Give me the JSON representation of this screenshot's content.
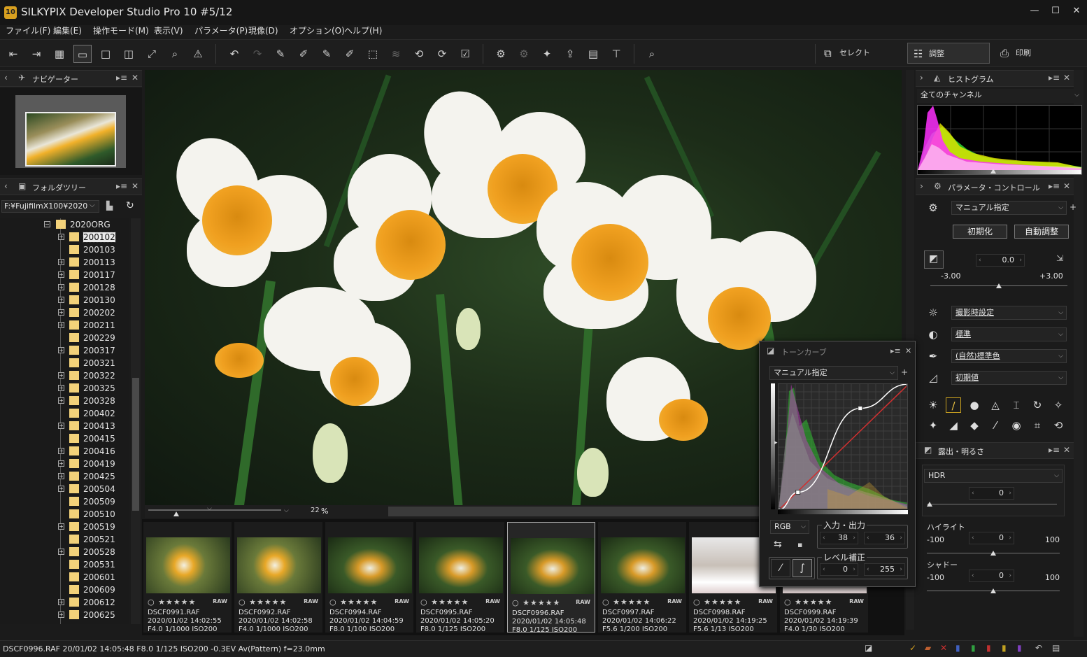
{
  "app": {
    "title": "SILKYPIX Developer Studio Pro 10   #5/12",
    "logo": "10"
  },
  "window": {
    "minimize": "—",
    "maximize": "☐",
    "close": "✕"
  },
  "menu": [
    "ファイル(F)",
    "編集(E)",
    "操作モード(M)",
    "表示(V)",
    "パラメータ(P)",
    "現像(D)",
    "オプション(O)",
    "ヘルプ(H)"
  ],
  "toolbar": {
    "icons": [
      "prev-image-icon",
      "next-image-icon",
      "grid-view-icon",
      "preview-filmstrip-icon",
      "single-view-icon",
      "compare-view-icon",
      "fullscreen-icon",
      "zoom-icon",
      "warning-icon",
      "undo-icon",
      "redo-icon",
      "copy-param-icon",
      "paste-param-icon",
      "paste-param2-icon",
      "paste-param3-icon",
      "crop-tool-icon",
      "layers-icon",
      "rotate-left-icon",
      "rotate-right-icon",
      "check-icon",
      "develop-icon",
      "batch-develop-icon",
      "plugin-icon",
      "export-icon",
      "slideshow-icon",
      "tools-icon",
      "search-icon"
    ],
    "modes": {
      "select": "セレクト",
      "adjust": "調整",
      "print": "印刷"
    }
  },
  "navigator": {
    "title": "ナビゲーター"
  },
  "folder_tree": {
    "title": "フォルダツリー",
    "path": "F:¥FujifilmX100¥2020",
    "root": "2020ORG",
    "items": [
      {
        "label": "200102",
        "expand": true,
        "selected": true
      },
      {
        "label": "200103",
        "expand": false
      },
      {
        "label": "200113",
        "expand": true
      },
      {
        "label": "200117",
        "expand": true
      },
      {
        "label": "200128",
        "expand": true
      },
      {
        "label": "200130",
        "expand": true
      },
      {
        "label": "200202",
        "expand": true
      },
      {
        "label": "200211",
        "expand": true
      },
      {
        "label": "200229",
        "expand": false
      },
      {
        "label": "200317",
        "expand": true
      },
      {
        "label": "200321",
        "expand": false
      },
      {
        "label": "200322",
        "expand": true
      },
      {
        "label": "200325",
        "expand": true
      },
      {
        "label": "200328",
        "expand": true
      },
      {
        "label": "200402",
        "expand": false
      },
      {
        "label": "200413",
        "expand": true
      },
      {
        "label": "200415",
        "expand": false
      },
      {
        "label": "200416",
        "expand": true
      },
      {
        "label": "200419",
        "expand": true
      },
      {
        "label": "200425",
        "expand": true
      },
      {
        "label": "200504",
        "expand": true
      },
      {
        "label": "200509",
        "expand": false
      },
      {
        "label": "200510",
        "expand": false
      },
      {
        "label": "200519",
        "expand": true
      },
      {
        "label": "200521",
        "expand": false
      },
      {
        "label": "200528",
        "expand": true
      },
      {
        "label": "200531",
        "expand": false
      },
      {
        "label": "200601",
        "expand": false
      },
      {
        "label": "200609",
        "expand": false
      },
      {
        "label": "200612",
        "expand": true
      },
      {
        "label": "200625",
        "expand": true
      }
    ]
  },
  "viewer": {
    "zoom": "22",
    "zoom_unit": "%"
  },
  "filmstrip": [
    {
      "name": "DSCF0991.RAF",
      "date": "2020/01/02 14:02:55",
      "exp": "F4.0 1/1000 ISO200",
      "tone": "a"
    },
    {
      "name": "DSCF0992.RAF",
      "date": "2020/01/02 14:02:58",
      "exp": "F4.0 1/1000 ISO200",
      "tone": "a"
    },
    {
      "name": "DSCF0994.RAF",
      "date": "2020/01/02 14:04:59",
      "exp": "F8.0 1/100 ISO200",
      "tone": "b"
    },
    {
      "name": "DSCF0995.RAF",
      "date": "2020/01/02 14:05:20",
      "exp": "F8.0 1/125 ISO200",
      "tone": "b"
    },
    {
      "name": "DSCF0996.RAF",
      "date": "2020/01/02 14:05:48",
      "exp": "F8.0 1/125 ISO200",
      "tone": "b",
      "selected": true
    },
    {
      "name": "DSCF0997.RAF",
      "date": "2020/01/02 14:06:22",
      "exp": "F5.6 1/200 ISO200",
      "tone": "b"
    },
    {
      "name": "DSCF0998.RAF",
      "date": "2020/01/02 14:19:25",
      "exp": "F5.6 1/13 ISO200",
      "tone": "c"
    },
    {
      "name": "DSCF0999.RAF",
      "date": "2020/01/02 14:19:39",
      "exp": "F4.0 1/30 ISO200",
      "tone": "c"
    }
  ],
  "thumb_rating": "○ ★★★★★",
  "thumb_raw": "RAW",
  "status": {
    "text": "DSCF0996.RAF 20/01/02 14:05:48 F8.0 1/125 ISO200 -0.3EV Av(Pattern) f=23.0mm"
  },
  "histogram": {
    "title": "ヒストグラム",
    "channel": "全てのチャンネル"
  },
  "param_control": {
    "title": "パラメータ・コントロール",
    "preset": "マニュアル指定",
    "init_btn": "初期化",
    "auto_btn": "自動調整",
    "exposure_value": "0.0",
    "exposure_min": "-3.00",
    "exposure_max": "+3.00",
    "exposure_level": 0.5,
    "wb": "撮影時設定",
    "tone": "標準",
    "color": "(自然)標準色",
    "sharp": "初期値"
  },
  "exposure_panel": {
    "title": "露出・明るさ",
    "hdr_label": "HDR",
    "hdr_value": "0",
    "highlight_label": "ハイライト",
    "highlight_min": "-100",
    "highlight_max": "100",
    "highlight_value": "0",
    "shadow_label": "シャドー",
    "shadow_min": "-100",
    "shadow_max": "100",
    "shadow_value": "0"
  },
  "tone_curve": {
    "title": "トーンカーブ",
    "preset": "マニュアル指定",
    "channel": "RGB",
    "io_label": "入力・出力",
    "input": "38",
    "output": "36",
    "level_label": "レベル補正",
    "level_low": "0",
    "level_high": "255",
    "points": [
      [
        0,
        0
      ],
      [
        38,
        36
      ],
      [
        160,
        206
      ],
      [
        255,
        255
      ]
    ]
  }
}
